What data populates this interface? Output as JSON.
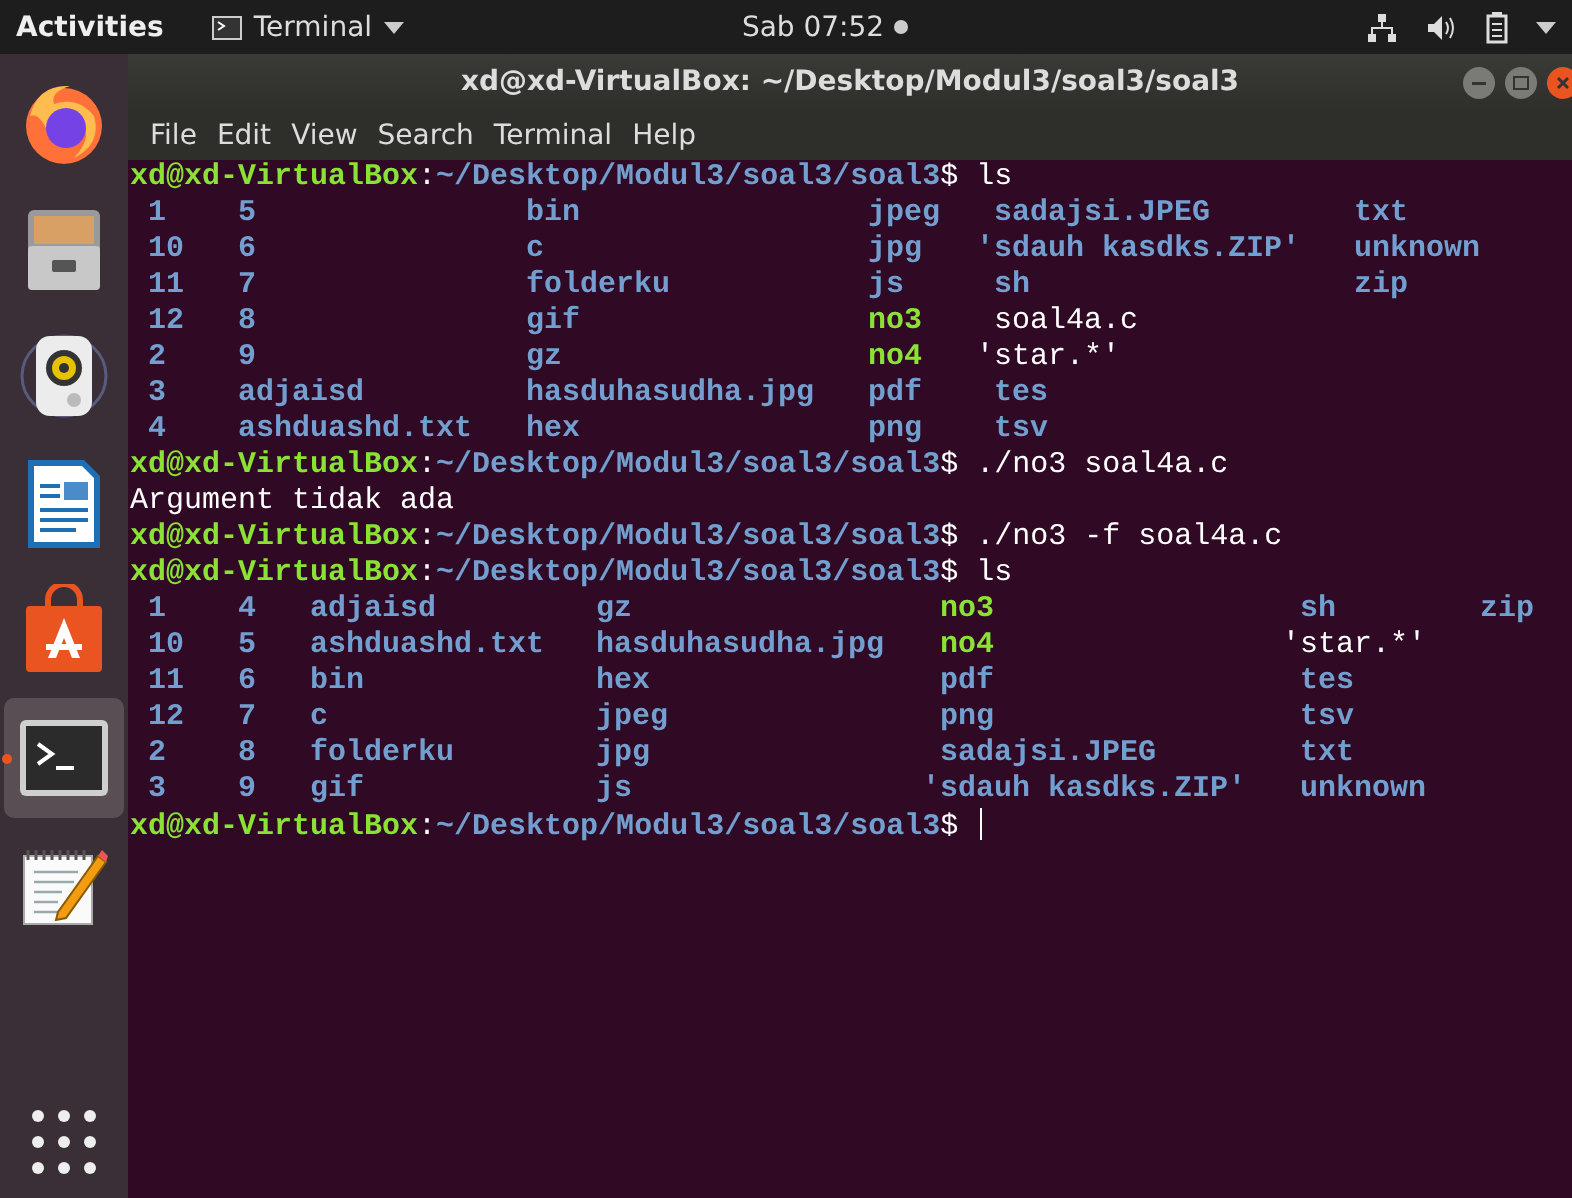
{
  "top_bar": {
    "activities": "Activities",
    "app_menu": "Terminal",
    "clock": "Sab 07:52"
  },
  "dock": {
    "items": [
      {
        "kind": "browser",
        "selected": false
      },
      {
        "kind": "files",
        "selected": false
      },
      {
        "kind": "music",
        "selected": false
      },
      {
        "kind": "writer",
        "selected": false
      },
      {
        "kind": "store",
        "selected": false
      },
      {
        "kind": "terminal",
        "selected": true
      },
      {
        "kind": "editor",
        "selected": false
      }
    ]
  },
  "window": {
    "title": "xd@xd-VirtualBox: ~/Desktop/Modul3/soal3/soal3"
  },
  "menu": [
    "File",
    "Edit",
    "View",
    "Search",
    "Terminal",
    "Help"
  ],
  "terminal": {
    "lines": [
      {
        "kind": "prompt",
        "user": "xd@xd-VirtualBox",
        "separator": ":",
        "path": "~/Desktop/Modul3/soal3/soal3",
        "sigil": "$",
        "command": "ls",
        "cursor": false
      },
      {
        "kind": "listing",
        "rows": [
          [
            {
              "text": "1",
              "kind": "dir"
            },
            {
              "text": "5",
              "kind": "dir"
            },
            {
              "text": "bin",
              "kind": "dir"
            },
            {
              "text": "jpeg",
              "kind": "dir"
            },
            {
              "text": "sadajsi.JPEG",
              "kind": "dir"
            },
            {
              "text": "txt",
              "kind": "dir"
            }
          ],
          [
            {
              "text": "10",
              "kind": "dir"
            },
            {
              "text": "6",
              "kind": "dir"
            },
            {
              "text": "c",
              "kind": "dir"
            },
            {
              "text": "jpg",
              "kind": "dir"
            },
            {
              "text": "'sdauh kasdks.ZIP'",
              "kind": "quoted-dir"
            },
            {
              "text": "unknown",
              "kind": "dir"
            }
          ],
          [
            {
              "text": "11",
              "kind": "dir"
            },
            {
              "text": "7",
              "kind": "dir"
            },
            {
              "text": "folderku",
              "kind": "dir"
            },
            {
              "text": "js",
              "kind": "dir"
            },
            {
              "text": "sh",
              "kind": "dir"
            },
            {
              "text": "zip",
              "kind": "dir"
            }
          ],
          [
            {
              "text": "12",
              "kind": "dir"
            },
            {
              "text": "8",
              "kind": "dir"
            },
            {
              "text": "gif",
              "kind": "dir"
            },
            {
              "text": "no3",
              "kind": "exec"
            },
            {
              "text": "soal4a.c",
              "kind": "file"
            }
          ],
          [
            {
              "text": "2",
              "kind": "dir"
            },
            {
              "text": "9",
              "kind": "dir"
            },
            {
              "text": "gz",
              "kind": "dir"
            },
            {
              "text": "no4",
              "kind": "exec"
            },
            {
              "text": "'star.*'",
              "kind": "quoted-file"
            }
          ],
          [
            {
              "text": "3",
              "kind": "dir"
            },
            {
              "text": "adjaisd",
              "kind": "dir"
            },
            {
              "text": "hasduhasudha.jpg",
              "kind": "dir"
            },
            {
              "text": "pdf",
              "kind": "dir"
            },
            {
              "text": "tes",
              "kind": "dir"
            }
          ],
          [
            {
              "text": "4",
              "kind": "dir"
            },
            {
              "text": "ashduashd.txt",
              "kind": "dir"
            },
            {
              "text": "hex",
              "kind": "dir"
            },
            {
              "text": "png",
              "kind": "dir"
            },
            {
              "text": "tsv",
              "kind": "dir"
            }
          ]
        ]
      },
      {
        "kind": "prompt",
        "user": "xd@xd-VirtualBox",
        "separator": ":",
        "path": "~/Desktop/Modul3/soal3/soal3",
        "sigil": "$",
        "command": "./no3 soal4a.c",
        "cursor": false
      },
      {
        "kind": "output",
        "text": "Argument tidak ada"
      },
      {
        "kind": "prompt",
        "user": "xd@xd-VirtualBox",
        "separator": ":",
        "path": "~/Desktop/Modul3/soal3/soal3",
        "sigil": "$",
        "command": "./no3 -f soal4a.c",
        "cursor": false
      },
      {
        "kind": "prompt",
        "user": "xd@xd-VirtualBox",
        "separator": ":",
        "path": "~/Desktop/Modul3/soal3/soal3",
        "sigil": "$",
        "command": "ls",
        "cursor": false
      },
      {
        "kind": "listing",
        "rows": [
          [
            {
              "text": "1",
              "kind": "dir"
            },
            {
              "text": "4",
              "kind": "dir"
            },
            {
              "text": "adjaisd",
              "kind": "dir"
            },
            {
              "text": "gz",
              "kind": "dir"
            },
            {
              "text": "no3",
              "kind": "exec"
            },
            {
              "text": "sh",
              "kind": "dir"
            },
            {
              "text": "zip",
              "kind": "dir"
            }
          ],
          [
            {
              "text": "10",
              "kind": "dir"
            },
            {
              "text": "5",
              "kind": "dir"
            },
            {
              "text": "ashduashd.txt",
              "kind": "dir"
            },
            {
              "text": "hasduhasudha.jpg",
              "kind": "dir"
            },
            {
              "text": "no4",
              "kind": "exec"
            },
            {
              "text": "'star.*'",
              "kind": "quoted-file"
            }
          ],
          [
            {
              "text": "11",
              "kind": "dir"
            },
            {
              "text": "6",
              "kind": "dir"
            },
            {
              "text": "bin",
              "kind": "dir"
            },
            {
              "text": "hex",
              "kind": "dir"
            },
            {
              "text": "pdf",
              "kind": "dir"
            },
            {
              "text": "tes",
              "kind": "dir"
            }
          ],
          [
            {
              "text": "12",
              "kind": "dir"
            },
            {
              "text": "7",
              "kind": "dir"
            },
            {
              "text": "c",
              "kind": "dir"
            },
            {
              "text": "jpeg",
              "kind": "dir"
            },
            {
              "text": "png",
              "kind": "dir"
            },
            {
              "text": "tsv",
              "kind": "dir"
            }
          ],
          [
            {
              "text": "2",
              "kind": "dir"
            },
            {
              "text": "8",
              "kind": "dir"
            },
            {
              "text": "folderku",
              "kind": "dir"
            },
            {
              "text": "jpg",
              "kind": "dir"
            },
            {
              "text": "sadajsi.JPEG",
              "kind": "dir"
            },
            {
              "text": "txt",
              "kind": "dir"
            }
          ],
          [
            {
              "text": "3",
              "kind": "dir"
            },
            {
              "text": "9",
              "kind": "dir"
            },
            {
              "text": "gif",
              "kind": "dir"
            },
            {
              "text": "js",
              "kind": "dir"
            },
            {
              "text": "'sdauh kasdks.ZIP'",
              "kind": "quoted-dir"
            },
            {
              "text": "unknown",
              "kind": "dir"
            }
          ]
        ]
      },
      {
        "kind": "prompt",
        "user": "xd@xd-VirtualBox",
        "separator": ":",
        "path": "~/Desktop/Modul3/soal3/soal3",
        "sigil": "$",
        "cursor": true
      }
    ]
  }
}
